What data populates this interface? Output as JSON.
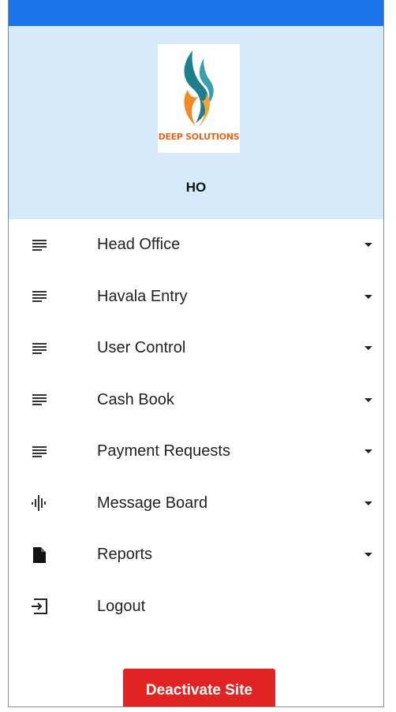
{
  "header": {
    "logo_text": "DEEP SOLUTIONS",
    "org_code": "HO"
  },
  "menu": {
    "items": [
      {
        "label": "Head Office",
        "icon": "list-icon",
        "has_dropdown": true
      },
      {
        "label": "Havala Entry",
        "icon": "list-icon",
        "has_dropdown": true
      },
      {
        "label": "User Control",
        "icon": "list-icon",
        "has_dropdown": true
      },
      {
        "label": "Cash Book",
        "icon": "list-icon",
        "has_dropdown": true
      },
      {
        "label": "Payment Requests",
        "icon": "list-icon",
        "has_dropdown": true
      },
      {
        "label": "Message Board",
        "icon": "audio-wave-icon",
        "has_dropdown": true
      },
      {
        "label": "Reports",
        "icon": "document-icon",
        "has_dropdown": true
      },
      {
        "label": "Logout",
        "icon": "logout-icon",
        "has_dropdown": false
      }
    ]
  },
  "actions": {
    "deactivate_label": "Deactivate Site"
  },
  "colors": {
    "top_bar": "#1a73e8",
    "header_bg": "#d6eafb",
    "danger": "#e02424",
    "logo_teal": "#1e7f8c",
    "logo_orange": "#f08a24"
  }
}
